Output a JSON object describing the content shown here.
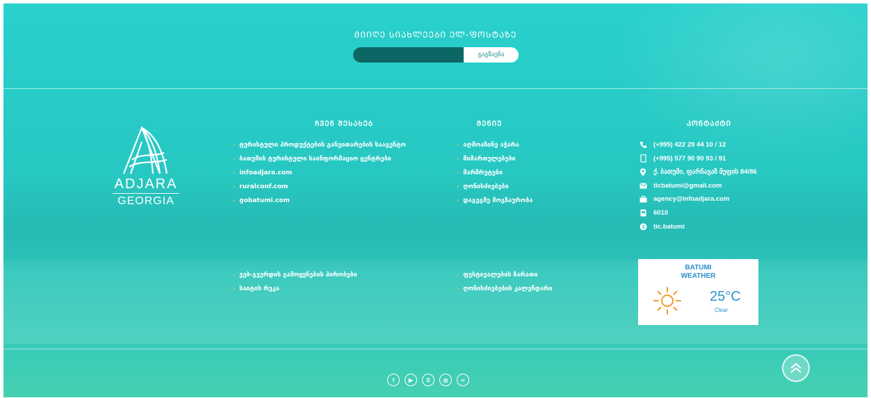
{
  "subscribe": {
    "title": "ᲛᲘᲘᲦᲔ ᲡᲘᲐᲮᲚᲔᲔᲑᲘ ᲔᲚ-ᲤᲝᲡᲢᲐᲖᲔ",
    "input_value": "",
    "button_label": "გაგზავნა"
  },
  "logo": {
    "line1": "ADJARA",
    "line2": "GEORGIA"
  },
  "about": {
    "title": "ᲩᲕᲔᲜ ᲨᲔᲡᲐᲮᲔᲑ",
    "links": [
      "ტურისტული პროდუქტების განვითარების სააგენტო",
      "ბათუმის ტურისტული საინფორმაციო ცენტრები",
      "infoadjara.com",
      "ruralconf.com",
      "gobatumi.com"
    ],
    "links2": [
      "ვებ-გვერდის გამოყენების პირობები",
      "საიტის რუკა"
    ]
  },
  "menu": {
    "title": "ᲛᲔᲜᲘᲣ",
    "links": [
      "აღმოაჩინე აჭარა",
      "მიმართულებები",
      "მარშრუტები",
      "ღონისძიებები",
      "დაგეგმე მოგზაურობა"
    ],
    "links2": [
      "ფესტივალების ზარათი",
      "ღონისძიებების კალენდარი"
    ]
  },
  "contact": {
    "title": "ᲙᲝᲜᲢᲐᲥᲢᲘ",
    "items": [
      {
        "icon": "phone-icon",
        "text": "(+995) 422 29 44 10 / 12"
      },
      {
        "icon": "mobile-icon",
        "text": "(+995) 577 90 90 93 / 91"
      },
      {
        "icon": "location-icon",
        "text": "ქ. ბათუმი, ფარნავაზ მეფის 84/86"
      },
      {
        "icon": "mail-icon",
        "text": "ticbatumi@gmail.com"
      },
      {
        "icon": "briefcase-icon",
        "text": "agency@infoadjara.com"
      },
      {
        "icon": "mailbox-icon",
        "text": "6010"
      },
      {
        "icon": "skype-icon",
        "text": "tic.batumi"
      }
    ]
  },
  "weather": {
    "city": "BATUMI",
    "label": "WEATHER",
    "temperature": "25°C",
    "condition": "Clear",
    "icon": "sun-icon",
    "color": "#2a8fd0",
    "sun_color": "#f39a2b"
  },
  "social": {
    "icons": [
      {
        "name": "facebook-icon",
        "glyph": "f"
      },
      {
        "name": "youtube-icon",
        "glyph": "▶"
      },
      {
        "name": "skype-icon",
        "glyph": "S"
      },
      {
        "name": "instagram-icon",
        "glyph": "◎"
      },
      {
        "name": "tripadvisor-icon",
        "glyph": "∞"
      }
    ]
  },
  "colors": {
    "accent": "#29d0cc",
    "chevron": "#f5c518",
    "input_bg": "#0c6664"
  }
}
